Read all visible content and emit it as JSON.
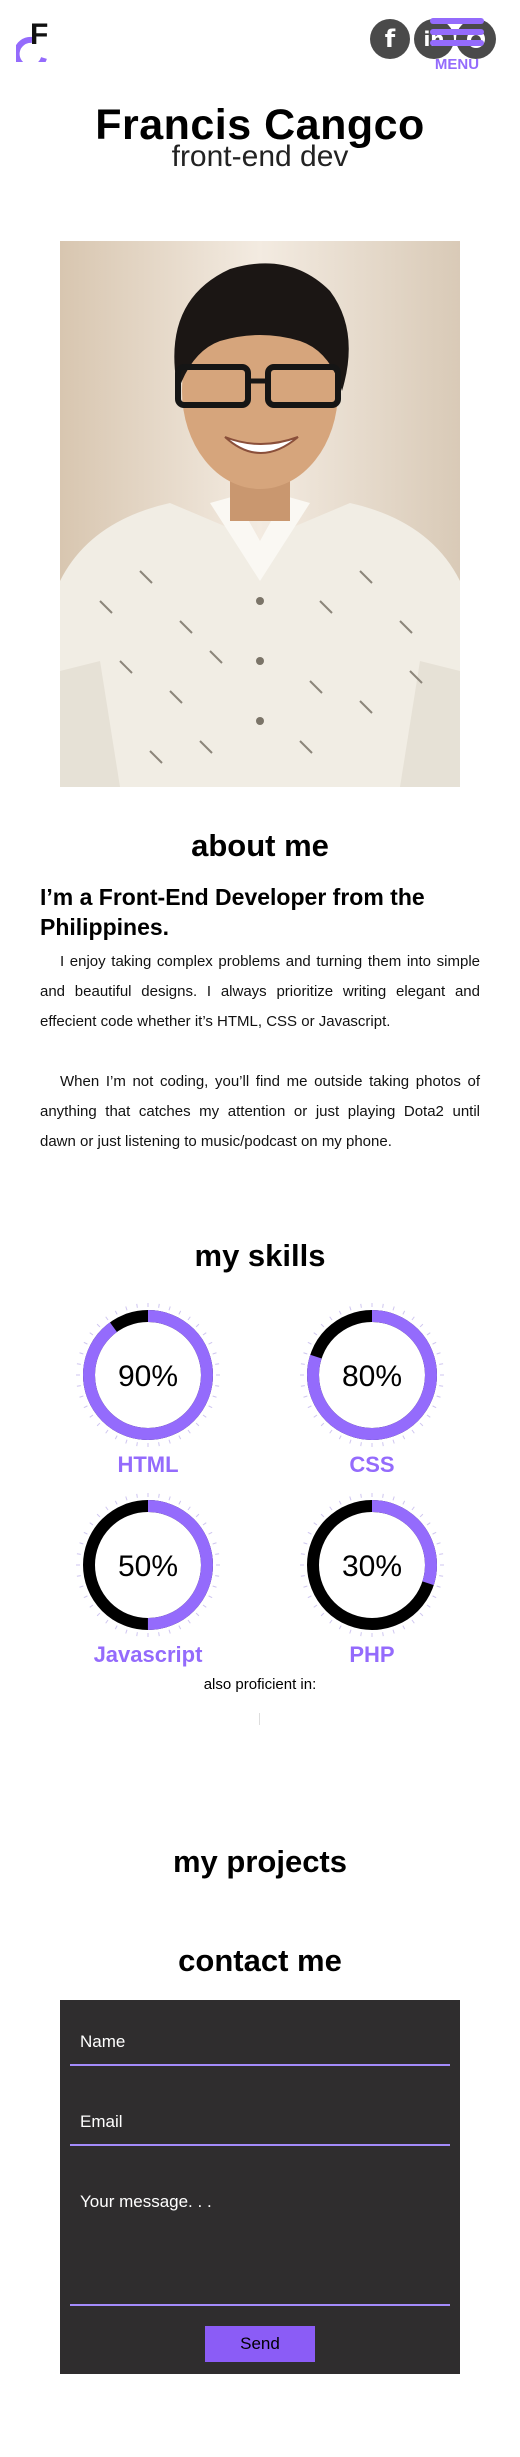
{
  "header": {
    "logo_letter": "F",
    "logo_icon": "fc-logo-icon",
    "social": [
      {
        "icon": "facebook-icon",
        "glyph": "f"
      },
      {
        "icon": "linkedin-icon",
        "glyph": "in"
      },
      {
        "icon": "github-icon",
        "glyph": ""
      }
    ],
    "menu_label": "MENU",
    "accent_color": "#946bfc"
  },
  "hero": {
    "name": "Francis Cangco",
    "role": "front-end dev",
    "photo_alt": "portrait"
  },
  "about": {
    "title": "about me",
    "heading": "I’m a Front-End Developer from the Philippines.",
    "paragraphs": [
      "I enjoy taking complex problems and turning them into simple and beautiful designs. I always prioritize writing elegant and effecient code whether it’s HTML, CSS or Javascript.",
      "When I’m not coding, you’ll find me outside taking photos of anything that catches my attention or just playing Dota2 until dawn or just listening to music/podcast on my phone."
    ]
  },
  "skills": {
    "title": "my skills",
    "items": [
      {
        "label": "HTML",
        "percent": 90,
        "display": "90%"
      },
      {
        "label": "CSS",
        "percent": 80,
        "display": "80%"
      },
      {
        "label": "Javascript",
        "percent": 50,
        "display": "50%"
      },
      {
        "label": "PHP",
        "percent": 30,
        "display": "30%"
      }
    ],
    "also_label": "also proficient in:",
    "ring_color": "#946bfc",
    "track_color": "#000000"
  },
  "projects": {
    "title": "my projects"
  },
  "contact": {
    "title": "contact me",
    "name_placeholder": "Name",
    "email_placeholder": "Email",
    "message_placeholder": "Your message. . .",
    "send_label": "Send"
  }
}
